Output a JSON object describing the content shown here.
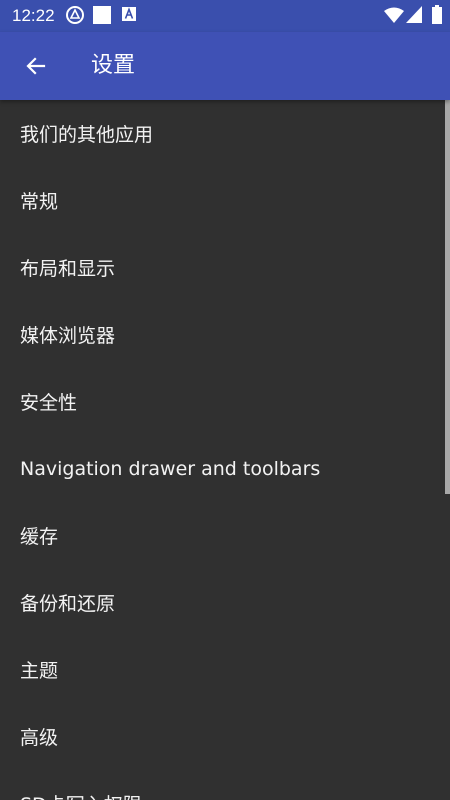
{
  "status_bar": {
    "time": "12:22",
    "icons": [
      "app-notification-icon",
      "white-square-icon",
      "a-badge-icon",
      "wifi-icon",
      "signal-icon",
      "battery-icon"
    ]
  },
  "app_bar": {
    "title": "设置",
    "back_icon": "arrow-left-icon",
    "color": "#3f51b5"
  },
  "colors": {
    "background": "#303030",
    "text": "#f2f2f2",
    "status_bar": "#3a4fad"
  },
  "settings": {
    "items": [
      {
        "label": "我们的其他应用"
      },
      {
        "label": "常规"
      },
      {
        "label": "布局和显示"
      },
      {
        "label": "媒体浏览器"
      },
      {
        "label": "安全性"
      },
      {
        "label": "Navigation drawer and toolbars"
      },
      {
        "label": "缓存"
      },
      {
        "label": "备份和还原"
      },
      {
        "label": "主题"
      },
      {
        "label": "高级"
      },
      {
        "label": "SD卡写入权限"
      }
    ]
  }
}
